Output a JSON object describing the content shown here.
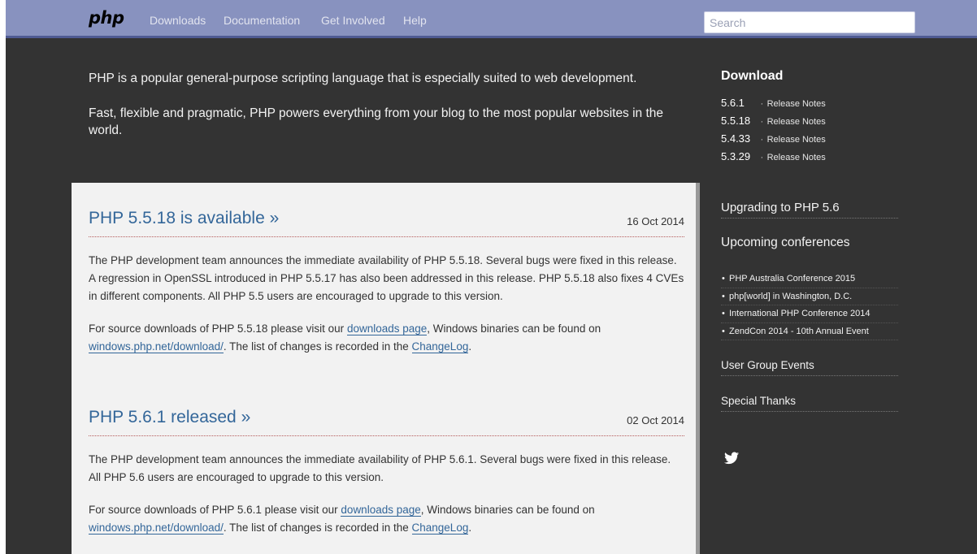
{
  "nav": {
    "logo": "php",
    "links": [
      "Downloads",
      "Documentation",
      "Get Involved",
      "Help"
    ],
    "search_placeholder": "Search"
  },
  "intro": {
    "p1": "PHP is a popular general-purpose scripting language that is especially suited to web development.",
    "p2": "Fast, flexible and pragmatic, PHP powers everything from your blog to the most popular websites in the world."
  },
  "news": [
    {
      "title": "PHP 5.5.18 is available »",
      "date": "16 Oct 2014",
      "body": "The PHP development team announces the immediate availability of PHP 5.5.18. Several bugs were fixed in this release. A regression in OpenSSL introduced in PHP 5.5.17 has also been addressed in this release. PHP 5.5.18 also fixes 4 CVEs in different components. All PHP 5.5 users are encouraged to upgrade to this version.",
      "dl_prefix": "For source downloads of PHP 5.5.18 please visit our ",
      "dl_link": "downloads page",
      "dl_mid": ", Windows binaries can be found on ",
      "win_link": "windows.php.net/download/",
      "dl_mid2": ". The list of changes is recorded in the ",
      "changelog_link": "ChangeLog",
      "dl_end": "."
    },
    {
      "title": "PHP 5.6.1 released »",
      "date": "02 Oct 2014",
      "body": "The PHP development team announces the immediate availability of PHP 5.6.1. Several bugs were fixed in this release. All PHP 5.6 users are encouraged to upgrade to this version.",
      "dl_prefix": "For source downloads of PHP 5.6.1 please visit our ",
      "dl_link": "downloads page",
      "dl_mid": ", Windows binaries can be found on ",
      "win_link": "windows.php.net/download/",
      "dl_mid2": ". The list of changes is recorded in the ",
      "changelog_link": "ChangeLog",
      "dl_end": "."
    }
  ],
  "sidebar": {
    "download_heading": "Download",
    "versions": [
      {
        "num": "5.6.1",
        "sep": "·",
        "link": "Release Notes"
      },
      {
        "num": "5.5.18",
        "sep": "·",
        "link": "Release Notes"
      },
      {
        "num": "5.4.33",
        "sep": "·",
        "link": "Release Notes"
      },
      {
        "num": "5.3.29",
        "sep": "·",
        "link": "Release Notes"
      }
    ],
    "upgrading": "Upgrading to PHP 5.6",
    "conferences_heading": "Upcoming conferences",
    "conferences": [
      "PHP Australia Conference 2015",
      "php[world] in Washington, D.C.",
      "International PHP Conference 2014",
      "ZendCon 2014 - 10th Annual Event"
    ],
    "user_group": "User Group Events",
    "special_thanks": "Special Thanks",
    "social_icon": "twitter-icon"
  },
  "colors": {
    "navbar": "#8892bf",
    "page_bg": "#333333",
    "news_bg": "#f2f2f2",
    "link": "#336699"
  }
}
